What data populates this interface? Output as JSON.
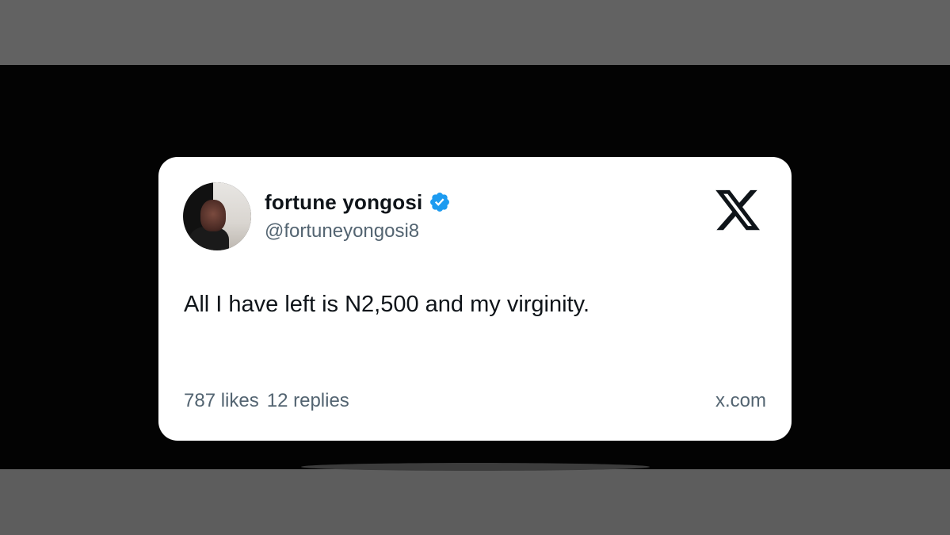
{
  "tweet": {
    "author": {
      "display_name": "fortune yongosi",
      "handle": "@fortuneyongosi8",
      "verified": true,
      "verified_color": "#1d9bf0"
    },
    "platform_icon": "x-logo-icon",
    "text": "All I have left is N2,500 and my virginity.",
    "stats": {
      "likes": "787 likes",
      "replies": "12 replies"
    },
    "source": "x.com"
  },
  "colors": {
    "card_background": "#ffffff",
    "primary_text": "#0f1419",
    "secondary_text": "#536471",
    "page_mid_band": "#030303",
    "page_outer_band": "#606060"
  }
}
